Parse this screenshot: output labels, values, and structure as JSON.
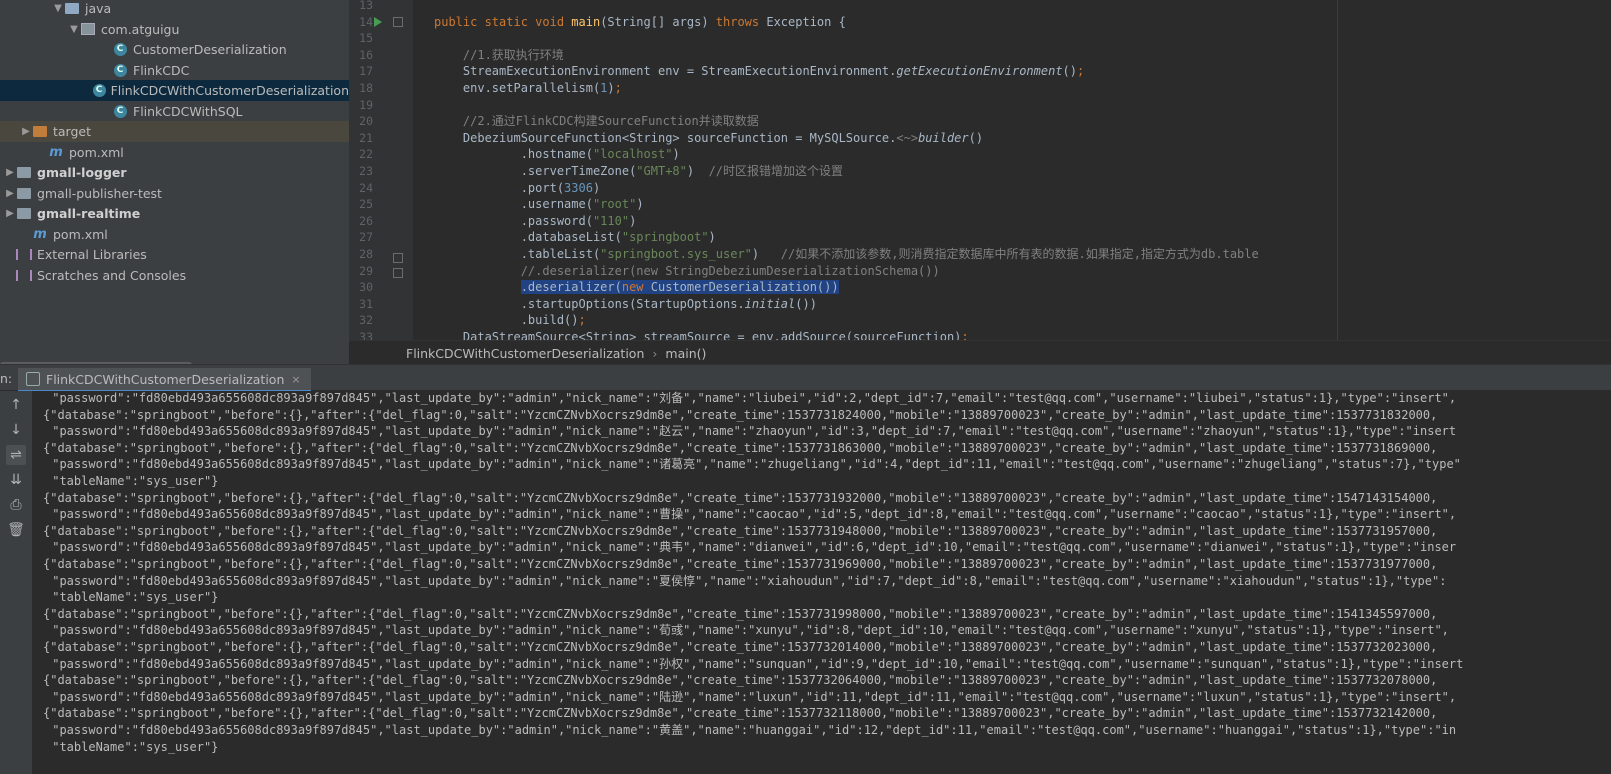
{
  "project_tree": {
    "items": [
      {
        "label": "java",
        "indent": 3,
        "arrow": "▼",
        "icon": "folder-icon"
      },
      {
        "label": "com.atguigu",
        "indent": 4,
        "arrow": "▼",
        "icon": "package-icon"
      },
      {
        "label": "CustomerDeserialization",
        "indent": 6,
        "arrow": "",
        "icon": "class-icon"
      },
      {
        "label": "FlinkCDC",
        "indent": 6,
        "arrow": "",
        "icon": "class-icon"
      },
      {
        "label": "FlinkCDCWithCustomerDeserialization",
        "indent": 6,
        "arrow": "",
        "icon": "class-icon",
        "selected": true
      },
      {
        "label": "FlinkCDCWithSQL",
        "indent": 6,
        "arrow": "",
        "icon": "class-icon"
      },
      {
        "label": "target",
        "indent": 1,
        "arrow": "▶",
        "icon": "folder-orange-icon",
        "target": true
      },
      {
        "label": "pom.xml",
        "indent": 2,
        "arrow": "",
        "icon": "maven-icon"
      },
      {
        "label": "gmall-logger",
        "indent": 0,
        "arrow": "▶",
        "icon": "module-folder-icon",
        "bold": true
      },
      {
        "label": "gmall-publisher-test",
        "indent": 0,
        "arrow": "▶",
        "icon": "module-folder-icon"
      },
      {
        "label": "gmall-realtime",
        "indent": 0,
        "arrow": "▶",
        "icon": "module-folder-icon",
        "bold": true
      },
      {
        "label": "pom.xml",
        "indent": 1,
        "arrow": "",
        "icon": "maven-icon"
      },
      {
        "label": "External Libraries",
        "indent": 0,
        "arrow": "",
        "icon": "libraries-icon"
      },
      {
        "label": "Scratches and Consoles",
        "indent": 0,
        "arrow": "",
        "icon": "scratches-icon"
      }
    ]
  },
  "editor": {
    "line_numbers": [
      "13",
      "14",
      "15",
      "16",
      "17",
      "18",
      "19",
      "20",
      "21",
      "22",
      "23",
      "24",
      "25",
      "26",
      "27",
      "28",
      "29",
      "30",
      "31",
      "32",
      "33"
    ],
    "lines": [
      {
        "n": "13",
        "html": ""
      },
      {
        "n": "14",
        "html": "<span class=\"kw\">public static void </span><span class=\"fn\">main</span>(String[] args) <span class=\"kw\">throws </span>Exception {"
      },
      {
        "n": "15",
        "html": ""
      },
      {
        "n": "16",
        "html": "    <span class=\"cm\">//1.获取执行环境</span>"
      },
      {
        "n": "17",
        "html": "    StreamExecutionEnvironment env = StreamExecutionEnvironment.<span class=\"it\">getExecutionEnvironment</span>()<span class=\"kw\">;</span>"
      },
      {
        "n": "18",
        "html": "    env.setParallelism(<span class=\"num\">1</span>)<span class=\"kw\">;</span>"
      },
      {
        "n": "19",
        "html": ""
      },
      {
        "n": "20",
        "html": "    <span class=\"cm\">//2.通过FlinkCDC构建SourceFunction并读取数据</span>"
      },
      {
        "n": "21",
        "html": "    DebeziumSourceFunction&lt;String&gt; sourceFunction = MySQLSource.<span class=\"cm\">&lt;~&gt;</span><span class=\"it\">builder</span>()"
      },
      {
        "n": "22",
        "html": "            .hostname(<span class=\"str\">\"localhost\"</span>)"
      },
      {
        "n": "23",
        "html": "            .serverTimeZone(<span class=\"str\">\"GMT+8\"</span>)  <span class=\"cm\">//时区报错增加这个设置</span>"
      },
      {
        "n": "24",
        "html": "            .port(<span class=\"num\">3306</span>)"
      },
      {
        "n": "25",
        "html": "            .username(<span class=\"str\">\"root\"</span>)"
      },
      {
        "n": "26",
        "html": "            .password(<span class=\"str\">\"110\"</span>)"
      },
      {
        "n": "27",
        "html": "            .databaseList(<span class=\"str\">\"springboot\"</span>)"
      },
      {
        "n": "28",
        "html": "            .tableList(<span class=\"str\">\"springboot.sys_user\"</span>)   <span class=\"cm\">//如果不添加该参数,则消费指定数据库中所有表的数据.如果指定,指定方式为db.table</span>"
      },
      {
        "n": "29",
        "html": "            <span class=\"cm\">//.deserializer(new StringDebeziumDeserializationSchema())</span>"
      },
      {
        "n": "30",
        "html": "            <span class=\"sel\">.deserializer(<span class=\"kw\">new </span>CustomerDeserialization())</span>"
      },
      {
        "n": "31",
        "html": "            .startupOptions(StartupOptions.<span class=\"it\">initial</span>())"
      },
      {
        "n": "32",
        "html": "            .build()<span class=\"kw\">;</span>"
      },
      {
        "n": "33",
        "html": "    DataStreamSource&lt;String&gt; streamSource = env.addSource(sourceFunction)<span class=\"kw\">;</span>"
      }
    ]
  },
  "breadcrumb": {
    "file": "FlinkCDCWithCustomerDeserialization",
    "method": "main()"
  },
  "run_window": {
    "prefix": "n:",
    "tab_label": "FlinkCDCWithCustomerDeserialization",
    "close_glyph": "×"
  },
  "console": {
    "lines": [
      " \"password\":\"fd80ebd493a655608dc893a9f897d845\",\"last_update_by\":\"admin\",\"nick_name\":\"刘备\",\"name\":\"liubei\",\"id\":2,\"dept_id\":7,\"email\":\"test@qq.com\",\"username\":\"liubei\",\"status\":1},\"type\":\"insert\",",
      "{\"database\":\"springboot\",\"before\":{},\"after\":{\"del_flag\":0,\"salt\":\"YzcmCZNvbXocrsz9dm8e\",\"create_time\":1537731824000,\"mobile\":\"13889700023\",\"create_by\":\"admin\",\"last_update_time\":1537731832000,",
      " \"password\":\"fd80ebd493a655608dc893a9f897d845\",\"last_update_by\":\"admin\",\"nick_name\":\"赵云\",\"name\":\"zhaoyun\",\"id\":3,\"dept_id\":7,\"email\":\"test@qq.com\",\"username\":\"zhaoyun\",\"status\":1},\"type\":\"insert",
      "{\"database\":\"springboot\",\"before\":{},\"after\":{\"del_flag\":0,\"salt\":\"YzcmCZNvbXocrsz9dm8e\",\"create_time\":1537731863000,\"mobile\":\"13889700023\",\"create_by\":\"admin\",\"last_update_time\":1537731869000,",
      " \"password\":\"fd80ebd493a655608dc893a9f897d845\",\"last_update_by\":\"admin\",\"nick_name\":\"诸葛亮\",\"name\":\"zhugeliang\",\"id\":4,\"dept_id\":11,\"email\":\"test@qq.com\",\"username\":\"zhugeliang\",\"status\":7},\"type\"",
      " \"tableName\":\"sys_user\"}",
      "{\"database\":\"springboot\",\"before\":{},\"after\":{\"del_flag\":0,\"salt\":\"YzcmCZNvbXocrsz9dm8e\",\"create_time\":1537731932000,\"mobile\":\"13889700023\",\"create_by\":\"admin\",\"last_update_time\":1547143154000,",
      " \"password\":\"fd80ebd493a655608dc893a9f897d845\",\"last_update_by\":\"admin\",\"nick_name\":\"曹操\",\"name\":\"caocao\",\"id\":5,\"dept_id\":8,\"email\":\"test@qq.com\",\"username\":\"caocao\",\"status\":1},\"type\":\"insert\",",
      "{\"database\":\"springboot\",\"before\":{},\"after\":{\"del_flag\":0,\"salt\":\"YzcmCZNvbXocrsz9dm8e\",\"create_time\":1537731948000,\"mobile\":\"13889700023\",\"create_by\":\"admin\",\"last_update_time\":1537731957000,",
      " \"password\":\"fd80ebd493a655608dc893a9f897d845\",\"last_update_by\":\"admin\",\"nick_name\":\"典韦\",\"name\":\"dianwei\",\"id\":6,\"dept_id\":10,\"email\":\"test@qq.com\",\"username\":\"dianwei\",\"status\":1},\"type\":\"inser",
      "{\"database\":\"springboot\",\"before\":{},\"after\":{\"del_flag\":0,\"salt\":\"YzcmCZNvbXocrsz9dm8e\",\"create_time\":1537731969000,\"mobile\":\"13889700023\",\"create_by\":\"admin\",\"last_update_time\":1537731977000,",
      " \"password\":\"fd80ebd493a655608dc893a9f897d845\",\"last_update_by\":\"admin\",\"nick_name\":\"夏侯惇\",\"name\":\"xiahoudun\",\"id\":7,\"dept_id\":8,\"email\":\"test@qq.com\",\"username\":\"xiahoudun\",\"status\":1},\"type\":",
      " \"tableName\":\"sys_user\"}",
      "{\"database\":\"springboot\",\"before\":{},\"after\":{\"del_flag\":0,\"salt\":\"YzcmCZNvbXocrsz9dm8e\",\"create_time\":1537731998000,\"mobile\":\"13889700023\",\"create_by\":\"admin\",\"last_update_time\":1541345597000,",
      " \"password\":\"fd80ebd493a655608dc893a9f897d845\",\"last_update_by\":\"admin\",\"nick_name\":\"荀彧\",\"name\":\"xunyu\",\"id\":8,\"dept_id\":10,\"email\":\"test@qq.com\",\"username\":\"xunyu\",\"status\":1},\"type\":\"insert\",",
      "{\"database\":\"springboot\",\"before\":{},\"after\":{\"del_flag\":0,\"salt\":\"YzcmCZNvbXocrsz9dm8e\",\"create_time\":1537732014000,\"mobile\":\"13889700023\",\"create_by\":\"admin\",\"last_update_time\":1537732023000,",
      " \"password\":\"fd80ebd493a655608dc893a9f897d845\",\"last_update_by\":\"admin\",\"nick_name\":\"孙权\",\"name\":\"sunquan\",\"id\":9,\"dept_id\":10,\"email\":\"test@qq.com\",\"username\":\"sunquan\",\"status\":1},\"type\":\"insert",
      "{\"database\":\"springboot\",\"before\":{},\"after\":{\"del_flag\":0,\"salt\":\"YzcmCZNvbXocrsz9dm8e\",\"create_time\":1537732064000,\"mobile\":\"13889700023\",\"create_by\":\"admin\",\"last_update_time\":1537732078000,",
      " \"password\":\"fd80ebd493a655608dc893a9f897d845\",\"last_update_by\":\"admin\",\"nick_name\":\"陆逊\",\"name\":\"luxun\",\"id\":11,\"dept_id\":11,\"email\":\"test@qq.com\",\"username\":\"luxun\",\"status\":1},\"type\":\"insert\",",
      "{\"database\":\"springboot\",\"before\":{},\"after\":{\"del_flag\":0,\"salt\":\"YzcmCZNvbXocrsz9dm8e\",\"create_time\":1537732118000,\"mobile\":\"13889700023\",\"create_by\":\"admin\",\"last_update_time\":1537732142000,",
      " \"password\":\"fd80ebd493a655608dc893a9f897d845\",\"last_update_by\":\"admin\",\"nick_name\":\"黄盖\",\"name\":\"huanggai\",\"id\":12,\"dept_id\":11,\"email\":\"test@qq.com\",\"username\":\"huanggai\",\"status\":1},\"type\":\"in",
      " \"tableName\":\"sys_user\"}"
    ]
  },
  "toolbar": {
    "buttons": [
      {
        "name": "up-arrow-icon",
        "glyph": "↑"
      },
      {
        "name": "down-arrow-icon",
        "glyph": "↓"
      },
      {
        "name": "soft-wrap-icon",
        "glyph": "⇌",
        "active": true
      },
      {
        "name": "scroll-to-end-icon",
        "glyph": "⇊"
      },
      {
        "name": "print-icon",
        "glyph": "⎙"
      },
      {
        "name": "trash-icon",
        "glyph": "🗑"
      }
    ]
  },
  "colors": {
    "background": "#2b2b2b",
    "panel": "#3c3f41",
    "keyword": "#cc7832",
    "string": "#6a8759",
    "comment": "#808080",
    "number": "#6897bb",
    "selection": "#214283"
  }
}
